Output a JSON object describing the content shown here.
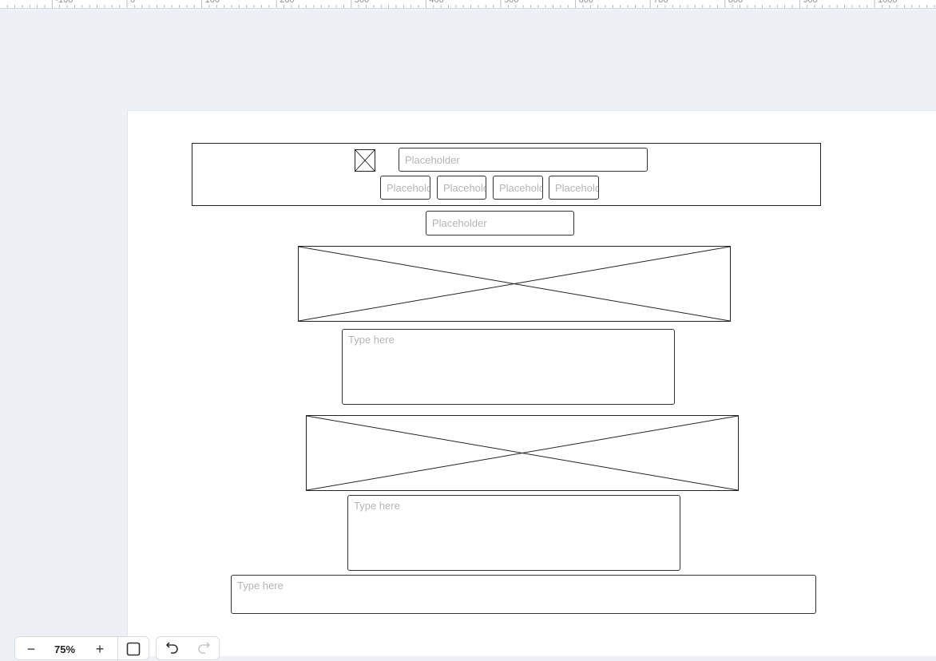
{
  "ruler": {
    "labels": [
      "-100",
      "0",
      "100",
      "200",
      "300",
      "400",
      "500",
      "600",
      "700",
      "800",
      "900",
      "1000"
    ]
  },
  "wireframe": {
    "nav_search_placeholder": "Placeholder",
    "nav_buttons": [
      "Placeholder",
      "Placeholder",
      "Placeholder",
      "Placeholder"
    ],
    "subnav_placeholder": "Placeholder",
    "textarea1_placeholder": "Type here",
    "textarea2_placeholder": "Type here",
    "footer_placeholder": "Type here"
  },
  "zoom_toolbar": {
    "zoom_out": "−",
    "zoom_level": "75%",
    "zoom_in": "+"
  }
}
